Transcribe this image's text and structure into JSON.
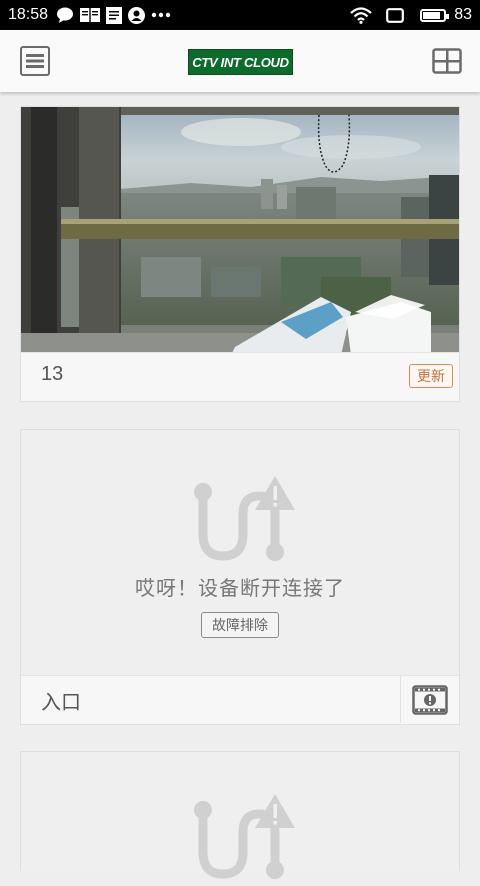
{
  "status_bar": {
    "time": "18:58",
    "battery_level": "83",
    "battery_fraction": 0.83,
    "left_icons": [
      "chat-bubble-icon",
      "reader-icon",
      "document-icon",
      "account-icon",
      "more-dots-icon"
    ],
    "right_icons": [
      "wifi-icon",
      "screen-icon",
      "battery-icon"
    ]
  },
  "header": {
    "logo_text": "CTV INT CLOUD",
    "menu_icon": "hamburger-menu-icon",
    "layout_icon": "grid-layout-icon"
  },
  "cameras": [
    {
      "name": "13",
      "status": "online",
      "action_label": "更新"
    },
    {
      "name": "入口",
      "status": "offline",
      "offline_message": "哎呀！设备断开连接了",
      "troubleshoot_label": "故障排除",
      "footer_icon": "film-alert-icon"
    },
    {
      "status": "offline"
    }
  ],
  "colors": {
    "logo_bg": "#0d6b2c",
    "update_accent": "#c8703d",
    "icon_gray": "#d0d0d0"
  }
}
